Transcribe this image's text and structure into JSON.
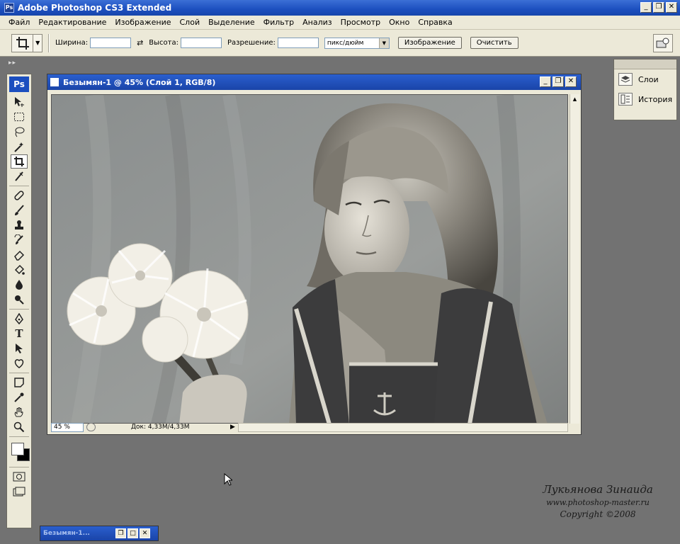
{
  "window": {
    "title": "Adobe Photoshop CS3 Extended",
    "app_icon": "Ps"
  },
  "menu": [
    "Файл",
    "Редактирование",
    "Изображение",
    "Слой",
    "Выделение",
    "Фильтр",
    "Анализ",
    "Просмотр",
    "Окно",
    "Справка"
  ],
  "options_bar": {
    "width_label": "Ширина:",
    "height_label": "Высота:",
    "resolution_label": "Разрешение:",
    "resolution_unit": "пикс/дюйм",
    "image_button": "Изображение",
    "clear_button": "Очистить"
  },
  "toolbox": {
    "logo": "Ps",
    "active_tool": "crop-tool"
  },
  "document": {
    "title": "Безымян-1 @ 45% (Слой 1, RGB/8)",
    "zoom": "45 %",
    "doc_size": "Док: 4,33М/4,33М"
  },
  "panels": {
    "layers_label": "Слои",
    "history_label": "История"
  },
  "minimized_doc": {
    "title": "Безымян-1..."
  },
  "watermark": {
    "name": "Лукьянова Зинаида",
    "site": "www.photoshop-master.ru",
    "copyright": "Copyright ©2008"
  },
  "colors": {
    "workspace": "#727272",
    "titlebar": "#1c4fbf",
    "chrome": "#ece9d8"
  }
}
